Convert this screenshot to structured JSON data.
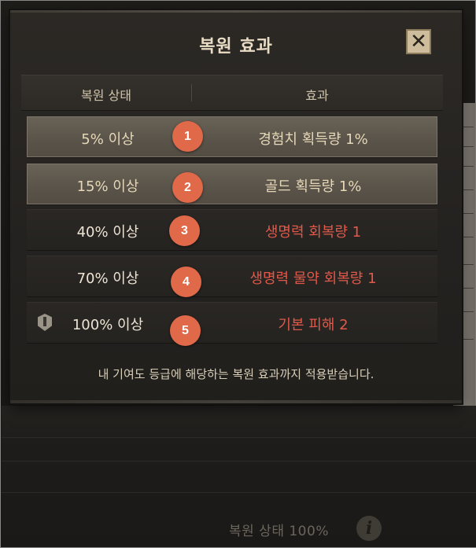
{
  "dialog": {
    "title": "복원 효과",
    "close_label": "✕",
    "columns": {
      "status": "복원 상태",
      "effect": "효과"
    },
    "rows": [
      {
        "status": "5% 이상",
        "effect": "경험치 획득량 1%",
        "active": true
      },
      {
        "status": "15% 이상",
        "effect": "골드 획득량 1%",
        "active": true
      },
      {
        "status": "40% 이상",
        "effect": "생명력 회복량 1",
        "active": false
      },
      {
        "status": "70% 이상",
        "effect": "생명력 물약 회복량 1",
        "active": false
      },
      {
        "status": "100% 이상",
        "effect": "기본 피해 2",
        "active": false,
        "icon": "shield-badge-icon"
      }
    ],
    "footer_note": "내 기여도 등급에 해당하는 복원 효과까지 적용받습니다."
  },
  "markers": [
    "1",
    "2",
    "3",
    "4",
    "5"
  ],
  "background": {
    "status_text": "복원 상태 100%",
    "info_icon": "info-icon",
    "info_glyph": "i"
  },
  "colors": {
    "active_text": "#e6d7b7",
    "inactive_effect": "#e0594a",
    "marker": "#e0694a"
  }
}
